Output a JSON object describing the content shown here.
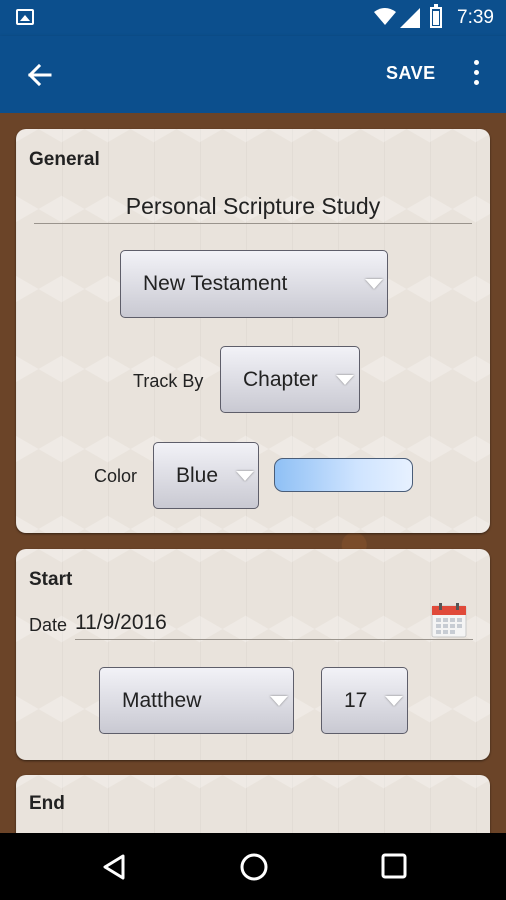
{
  "status_bar": {
    "time": "7:39",
    "icons": [
      "image-icon",
      "wifi-icon",
      "signal-icon",
      "battery-icon"
    ]
  },
  "app_bar": {
    "save_label": "SAVE",
    "color": "#0c4f8d"
  },
  "general": {
    "heading": "General",
    "title_value": "Personal Scripture Study",
    "collection_selected": "New Testament",
    "track_by_label": "Track By",
    "track_by_selected": "Chapter",
    "color_label": "Color",
    "color_selected": "Blue",
    "color_swatch": "#8fc0f5"
  },
  "start": {
    "heading": "Start",
    "date_label": "Date",
    "date_value": "11/9/2016",
    "book_selected": "Matthew",
    "chapter_selected": "17"
  },
  "end": {
    "heading": "End"
  }
}
